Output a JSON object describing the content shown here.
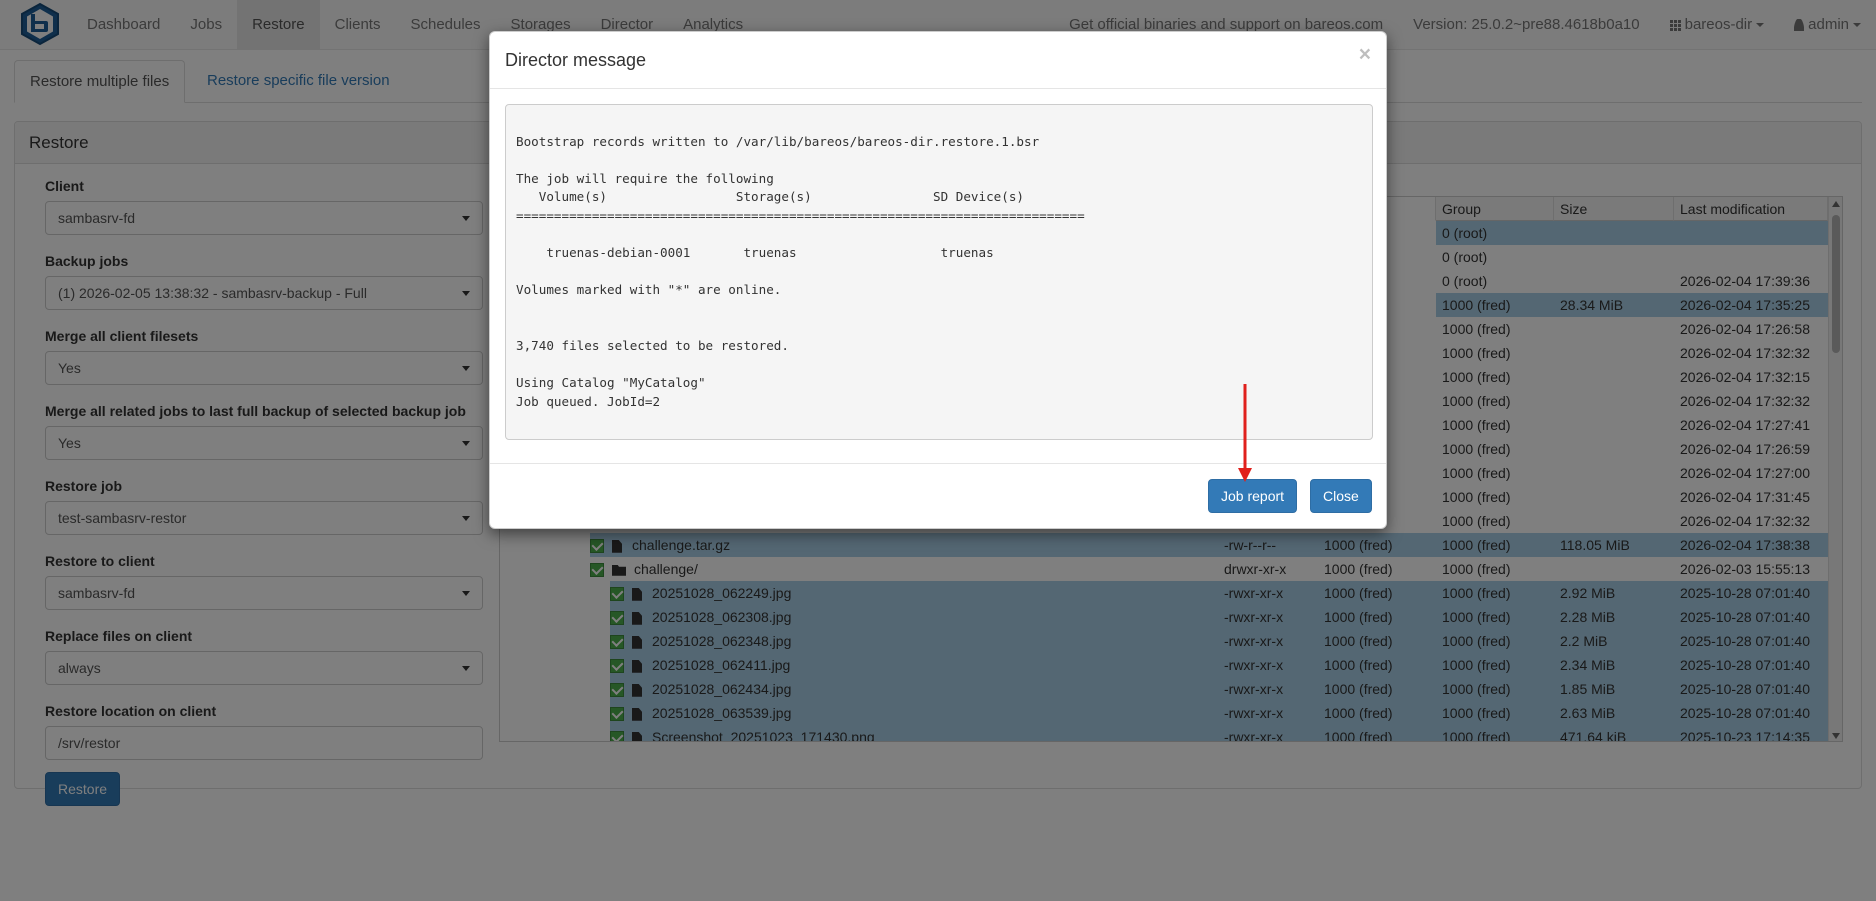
{
  "navbar": {
    "items": [
      "Dashboard",
      "Jobs",
      "Restore",
      "Clients",
      "Schedules",
      "Storages",
      "Director",
      "Analytics"
    ],
    "active_index": 2,
    "support_text": "Get official binaries and support on bareos.com",
    "version": "Version: 25.0.2~pre88.4618b0a10",
    "director": "bareos-dir",
    "user": "admin"
  },
  "tabs": {
    "active": "Restore multiple files",
    "other": "Restore specific file version"
  },
  "panel": {
    "title": "Restore"
  },
  "form": {
    "client_label": "Client",
    "client_value": "sambasrv-fd",
    "backup_jobs_label": "Backup jobs",
    "backup_jobs_value": "(1) 2026-02-05 13:38:32 - sambasrv-backup - Full",
    "merge_filesets_label": "Merge all client filesets",
    "merge_filesets_value": "Yes",
    "merge_jobs_label": "Merge all related jobs to last full backup of selected backup job",
    "merge_jobs_value": "Yes",
    "restore_job_label": "Restore job",
    "restore_job_value": "test-sambasrv-restor",
    "restore_client_label": "Restore to client",
    "restore_client_value": "sambasrv-fd",
    "replace_label": "Replace files on client",
    "replace_value": "always",
    "location_label": "Restore location on client",
    "location_value": "/srv/restor",
    "restore_button": "Restore"
  },
  "table": {
    "headers": {
      "group": "Group",
      "size": "Size",
      "modified": "Last modification"
    },
    "rows": [
      {
        "name": "",
        "perm": "",
        "user": "",
        "group": "0 (root)",
        "size": "",
        "mod": "",
        "sel": true,
        "type": "none",
        "level": 0
      },
      {
        "name": "",
        "perm": "",
        "user": "",
        "group": "0 (root)",
        "size": "",
        "mod": "",
        "sel": false,
        "type": "none",
        "level": 0
      },
      {
        "name": "",
        "perm": "",
        "user": "",
        "group": "0 (root)",
        "size": "",
        "mod": "2026-02-04 17:39:36",
        "sel": false,
        "type": "none",
        "level": 0
      },
      {
        "name": "",
        "perm": "",
        "user": "",
        "group": "1000 (fred)",
        "size": "28.34 MiB",
        "mod": "2026-02-04 17:35:25",
        "sel": true,
        "type": "none",
        "level": 0
      },
      {
        "name": "",
        "perm": "",
        "user": "",
        "group": "1000 (fred)",
        "size": "",
        "mod": "2026-02-04 17:26:58",
        "sel": false,
        "type": "none",
        "level": 0
      },
      {
        "name": "",
        "perm": "",
        "user": "",
        "group": "1000 (fred)",
        "size": "",
        "mod": "2026-02-04 17:32:32",
        "sel": false,
        "type": "none",
        "level": 0
      },
      {
        "name": "",
        "perm": "",
        "user": "",
        "group": "1000 (fred)",
        "size": "",
        "mod": "2026-02-04 17:32:15",
        "sel": false,
        "type": "none",
        "level": 0
      },
      {
        "name": "",
        "perm": "",
        "user": "",
        "group": "1000 (fred)",
        "size": "",
        "mod": "2026-02-04 17:32:32",
        "sel": false,
        "type": "none",
        "level": 0
      },
      {
        "name": "",
        "perm": "",
        "user": "",
        "group": "1000 (fred)",
        "size": "",
        "mod": "2026-02-04 17:27:41",
        "sel": false,
        "type": "none",
        "level": 0
      },
      {
        "name": "",
        "perm": "",
        "user": "",
        "group": "1000 (fred)",
        "size": "",
        "mod": "2026-02-04 17:26:59",
        "sel": false,
        "type": "none",
        "level": 0
      },
      {
        "name": "",
        "perm": "",
        "user": "",
        "group": "1000 (fred)",
        "size": "",
        "mod": "2026-02-04 17:27:00",
        "sel": false,
        "type": "none",
        "level": 0
      },
      {
        "name": "",
        "perm": "",
        "user": "",
        "group": "1000 (fred)",
        "size": "",
        "mod": "2026-02-04 17:31:45",
        "sel": false,
        "type": "none",
        "level": 0
      },
      {
        "name": "",
        "perm": "",
        "user": "",
        "group": "1000 (fred)",
        "size": "",
        "mod": "2026-02-04 17:32:32",
        "sel": false,
        "type": "none",
        "level": 0
      },
      {
        "name": "challenge.tar.gz",
        "perm": "-rw-r--r--",
        "user": "1000 (fred)",
        "group": "1000 (fred)",
        "size": "118.05 MiB",
        "mod": "2026-02-04 17:38:38",
        "sel": true,
        "type": "file",
        "level": 1
      },
      {
        "name": "challenge/",
        "perm": "drwxr-xr-x",
        "user": "1000 (fred)",
        "group": "1000 (fred)",
        "size": "",
        "mod": "2026-02-03 15:55:13",
        "sel": false,
        "type": "dir",
        "level": 1
      },
      {
        "name": "20251028_062249.jpg",
        "perm": "-rwxr-xr-x",
        "user": "1000 (fred)",
        "group": "1000 (fred)",
        "size": "2.92 MiB",
        "mod": "2025-10-28 07:01:40",
        "sel": true,
        "type": "file",
        "level": 2
      },
      {
        "name": "20251028_062308.jpg",
        "perm": "-rwxr-xr-x",
        "user": "1000 (fred)",
        "group": "1000 (fred)",
        "size": "2.28 MiB",
        "mod": "2025-10-28 07:01:40",
        "sel": true,
        "type": "file",
        "level": 2
      },
      {
        "name": "20251028_062348.jpg",
        "perm": "-rwxr-xr-x",
        "user": "1000 (fred)",
        "group": "1000 (fred)",
        "size": "2.2 MiB",
        "mod": "2025-10-28 07:01:40",
        "sel": true,
        "type": "file",
        "level": 2
      },
      {
        "name": "20251028_062411.jpg",
        "perm": "-rwxr-xr-x",
        "user": "1000 (fred)",
        "group": "1000 (fred)",
        "size": "2.34 MiB",
        "mod": "2025-10-28 07:01:40",
        "sel": true,
        "type": "file",
        "level": 2
      },
      {
        "name": "20251028_062434.jpg",
        "perm": "-rwxr-xr-x",
        "user": "1000 (fred)",
        "group": "1000 (fred)",
        "size": "1.85 MiB",
        "mod": "2025-10-28 07:01:40",
        "sel": true,
        "type": "file",
        "level": 2
      },
      {
        "name": "20251028_063539.jpg",
        "perm": "-rwxr-xr-x",
        "user": "1000 (fred)",
        "group": "1000 (fred)",
        "size": "2.63 MiB",
        "mod": "2025-10-28 07:01:40",
        "sel": true,
        "type": "file",
        "level": 2
      },
      {
        "name": "Screenshot_20251023_171430.png",
        "perm": "-rwxr-xr-x",
        "user": "1000 (fred)",
        "group": "1000 (fred)",
        "size": "471.64 kiB",
        "mod": "2025-10-23 17:14:35",
        "sel": true,
        "type": "file",
        "level": 2
      }
    ]
  },
  "modal": {
    "title": "Director message",
    "close_symbol": "×",
    "message": "\nBootstrap records written to /var/lib/bareos/bareos-dir.restore.1.bsr\n\nThe job will require the following\n   Volume(s)                 Storage(s)                SD Device(s)\n===========================================================================\n\n    truenas-debian-0001       truenas                   truenas\n\nVolumes marked with \"*\" are online.\n\n\n3,740 files selected to be restored.\n\nUsing Catalog \"MyCatalog\"\nJob queued. JobId=2\n",
    "job_report_button": "Job report",
    "close_button": "Close"
  },
  "colors": {
    "primary": "#337ab7",
    "selected_row": "#a9cfe6",
    "annotation_arrow": "#e0201c"
  }
}
